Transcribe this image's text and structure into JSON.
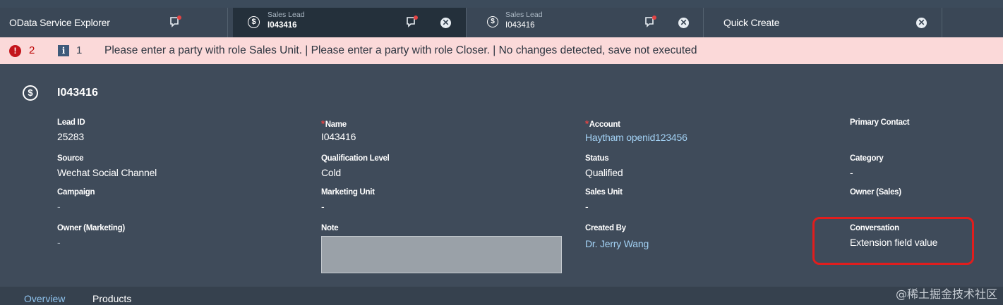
{
  "tabs": [
    {
      "title": "OData Service Explorer"
    },
    {
      "subtitle": "Sales Lead",
      "title": "I043416",
      "dollar": "$",
      "close": "✕"
    },
    {
      "subtitle": "Sales Lead",
      "title": "I043416",
      "dollar": "$",
      "close": "✕"
    },
    {
      "title": "Quick Create",
      "close": "✕"
    }
  ],
  "messages": {
    "error_count": "2",
    "info_count": "1",
    "error_icon": "!",
    "info_icon": "i",
    "text": "Please enter a party with role Sales Unit. | Please enter a party with role Closer. | No changes detected, save not executed"
  },
  "object": {
    "icon": "$",
    "title": "I043416"
  },
  "fields": {
    "lead_id": {
      "label": "Lead ID",
      "value": "25283"
    },
    "name": {
      "label": "Name",
      "value": "I043416",
      "required": "*"
    },
    "account": {
      "label": "Account",
      "value": "Haytham openid123456",
      "required": "*"
    },
    "primary_contact": {
      "label": "Primary Contact",
      "value": ""
    },
    "source": {
      "label": "Source",
      "value": "Wechat Social Channel"
    },
    "qualification_level": {
      "label": "Qualification Level",
      "value": "Cold"
    },
    "status": {
      "label": "Status",
      "value": "Qualified"
    },
    "category": {
      "label": "Category",
      "value": "-"
    },
    "campaign": {
      "label": "Campaign",
      "value": "-"
    },
    "marketing_unit": {
      "label": "Marketing Unit",
      "value": "-"
    },
    "sales_unit": {
      "label": "Sales Unit",
      "value": "-"
    },
    "owner_sales": {
      "label": "Owner (Sales)",
      "value": ""
    },
    "owner_marketing": {
      "label": "Owner (Marketing)",
      "value": "-"
    },
    "note": {
      "label": "Note"
    },
    "created_by": {
      "label": "Created By",
      "value": "Dr. Jerry Wang"
    },
    "conversation": {
      "label": "Conversation",
      "value": "Extension field value"
    }
  },
  "bottom_tabs": [
    {
      "label": "Overview"
    },
    {
      "label": "Products"
    }
  ],
  "watermark": "@稀土掘金技术社区",
  "colors": {
    "background": "#3f4b5a",
    "tabbar": "#3a4756",
    "active_tab": "#24303b",
    "message_strip": "#fbd9d9",
    "error": "#c4141b",
    "link": "#a3d2f5",
    "highlight": "#e11d1d"
  }
}
